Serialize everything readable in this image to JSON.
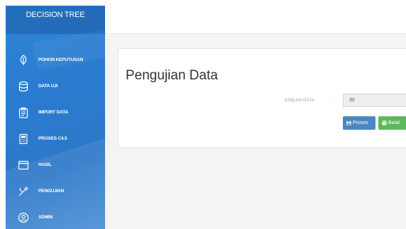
{
  "sidebar": {
    "brand": "DECISION TREE",
    "items": [
      {
        "label": "POHON KEPUTUSAN",
        "icon": "leaf-icon"
      },
      {
        "label": "DATA UJI",
        "icon": "database-icon"
      },
      {
        "label": "IMPORT DATA",
        "icon": "clipboard-icon"
      },
      {
        "label": "PROSES C4.5",
        "icon": "calculator-icon"
      },
      {
        "label": "HASIL",
        "icon": "window-icon"
      },
      {
        "label": "PENGUJIAN",
        "icon": "tools-icon"
      },
      {
        "label": "ADMIN",
        "icon": "user-circle-icon"
      }
    ]
  },
  "main": {
    "title": "Pengujian Data",
    "form": {
      "jumlah_label": "JUMLAH DATA",
      "separator": ":",
      "jumlah_value": "30",
      "proses_label": "Proses",
      "batal_label": "Batal"
    }
  },
  "colors": {
    "sidebar": "#2a7bcf",
    "proses": "#4a88c4",
    "batal": "#5cb85c"
  }
}
